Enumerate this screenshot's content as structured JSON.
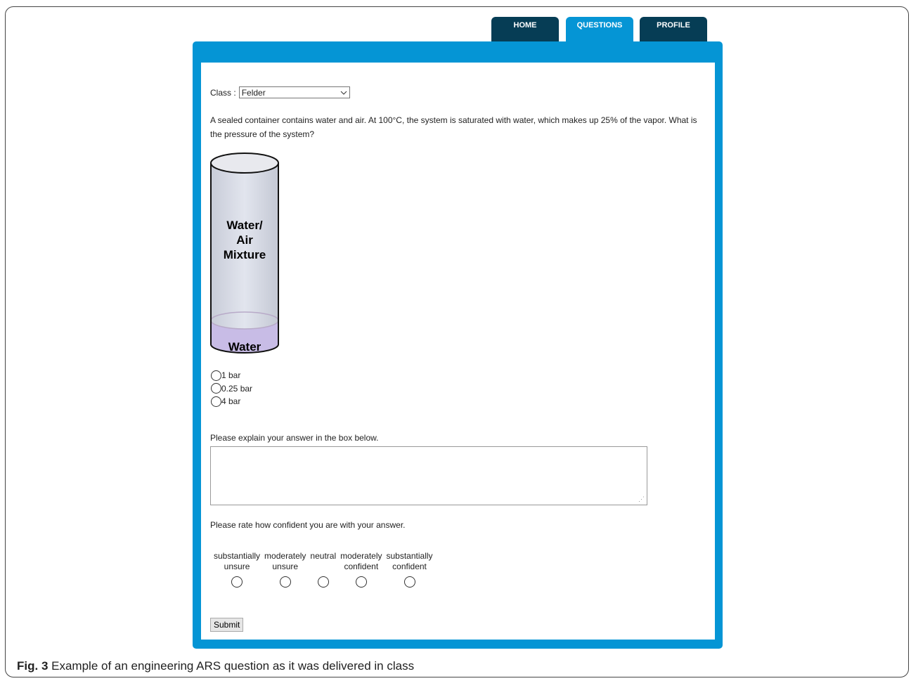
{
  "nav": {
    "home": "HOME",
    "questions": "QUESTIONS",
    "profile": "PROFILE"
  },
  "class_selector": {
    "label": "Class :",
    "value": "Felder"
  },
  "question": {
    "text": "A sealed container contains water and air. At 100°C, the system is saturated with water, which makes up 25% of the vapor. What is the pressure of the system?"
  },
  "illustration": {
    "upper_label_lines": [
      "Water/",
      "Air",
      "Mixture"
    ],
    "lower_label": "Water"
  },
  "options": [
    {
      "label": "1 bar"
    },
    {
      "label": "0.25 bar"
    },
    {
      "label": "4 bar"
    }
  ],
  "explain": {
    "label": "Please explain your answer in the box below.",
    "value": ""
  },
  "confidence": {
    "label": "Please rate how confident you are with your answer.",
    "levels": [
      {
        "line1": "substantially",
        "line2": "unsure"
      },
      {
        "line1": "moderately",
        "line2": "unsure"
      },
      {
        "line1": "neutral",
        "line2": ""
      },
      {
        "line1": "moderately",
        "line2": "confident"
      },
      {
        "line1": "substantially",
        "line2": "confident"
      }
    ]
  },
  "submit_label": "Submit",
  "caption": {
    "fig": "Fig. 3",
    "text": " Example of an engineering ARS question as it was delivered in class"
  },
  "colors": {
    "panel_blue": "#0595d5",
    "tab_dark": "#063d55"
  }
}
